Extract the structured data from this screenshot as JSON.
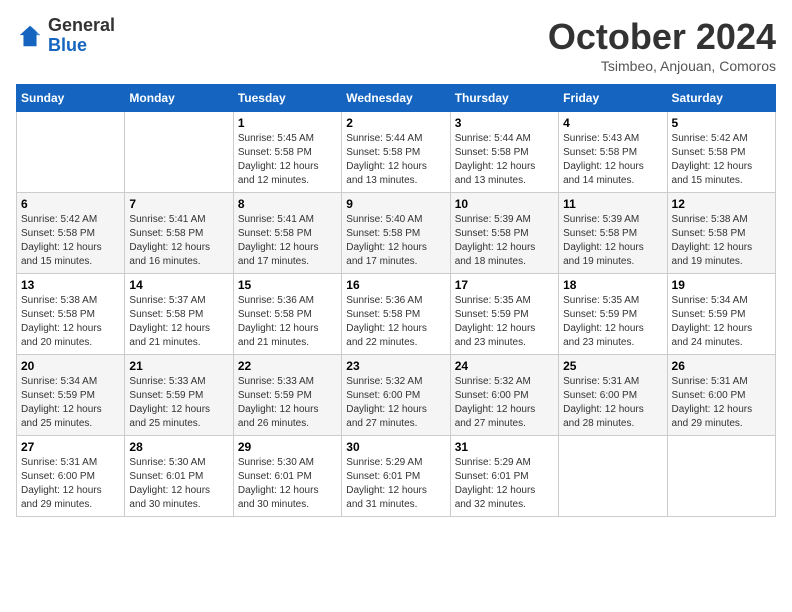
{
  "header": {
    "logo_line1": "General",
    "logo_line2": "Blue",
    "month": "October 2024",
    "location": "Tsimbeo, Anjouan, Comoros"
  },
  "weekdays": [
    "Sunday",
    "Monday",
    "Tuesday",
    "Wednesday",
    "Thursday",
    "Friday",
    "Saturday"
  ],
  "weeks": [
    [
      {
        "day": "",
        "sunrise": "",
        "sunset": "",
        "daylight": ""
      },
      {
        "day": "",
        "sunrise": "",
        "sunset": "",
        "daylight": ""
      },
      {
        "day": "1",
        "sunrise": "Sunrise: 5:45 AM",
        "sunset": "Sunset: 5:58 PM",
        "daylight": "Daylight: 12 hours and 12 minutes."
      },
      {
        "day": "2",
        "sunrise": "Sunrise: 5:44 AM",
        "sunset": "Sunset: 5:58 PM",
        "daylight": "Daylight: 12 hours and 13 minutes."
      },
      {
        "day": "3",
        "sunrise": "Sunrise: 5:44 AM",
        "sunset": "Sunset: 5:58 PM",
        "daylight": "Daylight: 12 hours and 13 minutes."
      },
      {
        "day": "4",
        "sunrise": "Sunrise: 5:43 AM",
        "sunset": "Sunset: 5:58 PM",
        "daylight": "Daylight: 12 hours and 14 minutes."
      },
      {
        "day": "5",
        "sunrise": "Sunrise: 5:42 AM",
        "sunset": "Sunset: 5:58 PM",
        "daylight": "Daylight: 12 hours and 15 minutes."
      }
    ],
    [
      {
        "day": "6",
        "sunrise": "Sunrise: 5:42 AM",
        "sunset": "Sunset: 5:58 PM",
        "daylight": "Daylight: 12 hours and 15 minutes."
      },
      {
        "day": "7",
        "sunrise": "Sunrise: 5:41 AM",
        "sunset": "Sunset: 5:58 PM",
        "daylight": "Daylight: 12 hours and 16 minutes."
      },
      {
        "day": "8",
        "sunrise": "Sunrise: 5:41 AM",
        "sunset": "Sunset: 5:58 PM",
        "daylight": "Daylight: 12 hours and 17 minutes."
      },
      {
        "day": "9",
        "sunrise": "Sunrise: 5:40 AM",
        "sunset": "Sunset: 5:58 PM",
        "daylight": "Daylight: 12 hours and 17 minutes."
      },
      {
        "day": "10",
        "sunrise": "Sunrise: 5:39 AM",
        "sunset": "Sunset: 5:58 PM",
        "daylight": "Daylight: 12 hours and 18 minutes."
      },
      {
        "day": "11",
        "sunrise": "Sunrise: 5:39 AM",
        "sunset": "Sunset: 5:58 PM",
        "daylight": "Daylight: 12 hours and 19 minutes."
      },
      {
        "day": "12",
        "sunrise": "Sunrise: 5:38 AM",
        "sunset": "Sunset: 5:58 PM",
        "daylight": "Daylight: 12 hours and 19 minutes."
      }
    ],
    [
      {
        "day": "13",
        "sunrise": "Sunrise: 5:38 AM",
        "sunset": "Sunset: 5:58 PM",
        "daylight": "Daylight: 12 hours and 20 minutes."
      },
      {
        "day": "14",
        "sunrise": "Sunrise: 5:37 AM",
        "sunset": "Sunset: 5:58 PM",
        "daylight": "Daylight: 12 hours and 21 minutes."
      },
      {
        "day": "15",
        "sunrise": "Sunrise: 5:36 AM",
        "sunset": "Sunset: 5:58 PM",
        "daylight": "Daylight: 12 hours and 21 minutes."
      },
      {
        "day": "16",
        "sunrise": "Sunrise: 5:36 AM",
        "sunset": "Sunset: 5:58 PM",
        "daylight": "Daylight: 12 hours and 22 minutes."
      },
      {
        "day": "17",
        "sunrise": "Sunrise: 5:35 AM",
        "sunset": "Sunset: 5:59 PM",
        "daylight": "Daylight: 12 hours and 23 minutes."
      },
      {
        "day": "18",
        "sunrise": "Sunrise: 5:35 AM",
        "sunset": "Sunset: 5:59 PM",
        "daylight": "Daylight: 12 hours and 23 minutes."
      },
      {
        "day": "19",
        "sunrise": "Sunrise: 5:34 AM",
        "sunset": "Sunset: 5:59 PM",
        "daylight": "Daylight: 12 hours and 24 minutes."
      }
    ],
    [
      {
        "day": "20",
        "sunrise": "Sunrise: 5:34 AM",
        "sunset": "Sunset: 5:59 PM",
        "daylight": "Daylight: 12 hours and 25 minutes."
      },
      {
        "day": "21",
        "sunrise": "Sunrise: 5:33 AM",
        "sunset": "Sunset: 5:59 PM",
        "daylight": "Daylight: 12 hours and 25 minutes."
      },
      {
        "day": "22",
        "sunrise": "Sunrise: 5:33 AM",
        "sunset": "Sunset: 5:59 PM",
        "daylight": "Daylight: 12 hours and 26 minutes."
      },
      {
        "day": "23",
        "sunrise": "Sunrise: 5:32 AM",
        "sunset": "Sunset: 6:00 PM",
        "daylight": "Daylight: 12 hours and 27 minutes."
      },
      {
        "day": "24",
        "sunrise": "Sunrise: 5:32 AM",
        "sunset": "Sunset: 6:00 PM",
        "daylight": "Daylight: 12 hours and 27 minutes."
      },
      {
        "day": "25",
        "sunrise": "Sunrise: 5:31 AM",
        "sunset": "Sunset: 6:00 PM",
        "daylight": "Daylight: 12 hours and 28 minutes."
      },
      {
        "day": "26",
        "sunrise": "Sunrise: 5:31 AM",
        "sunset": "Sunset: 6:00 PM",
        "daylight": "Daylight: 12 hours and 29 minutes."
      }
    ],
    [
      {
        "day": "27",
        "sunrise": "Sunrise: 5:31 AM",
        "sunset": "Sunset: 6:00 PM",
        "daylight": "Daylight: 12 hours and 29 minutes."
      },
      {
        "day": "28",
        "sunrise": "Sunrise: 5:30 AM",
        "sunset": "Sunset: 6:01 PM",
        "daylight": "Daylight: 12 hours and 30 minutes."
      },
      {
        "day": "29",
        "sunrise": "Sunrise: 5:30 AM",
        "sunset": "Sunset: 6:01 PM",
        "daylight": "Daylight: 12 hours and 30 minutes."
      },
      {
        "day": "30",
        "sunrise": "Sunrise: 5:29 AM",
        "sunset": "Sunset: 6:01 PM",
        "daylight": "Daylight: 12 hours and 31 minutes."
      },
      {
        "day": "31",
        "sunrise": "Sunrise: 5:29 AM",
        "sunset": "Sunset: 6:01 PM",
        "daylight": "Daylight: 12 hours and 32 minutes."
      },
      {
        "day": "",
        "sunrise": "",
        "sunset": "",
        "daylight": ""
      },
      {
        "day": "",
        "sunrise": "",
        "sunset": "",
        "daylight": ""
      }
    ]
  ]
}
